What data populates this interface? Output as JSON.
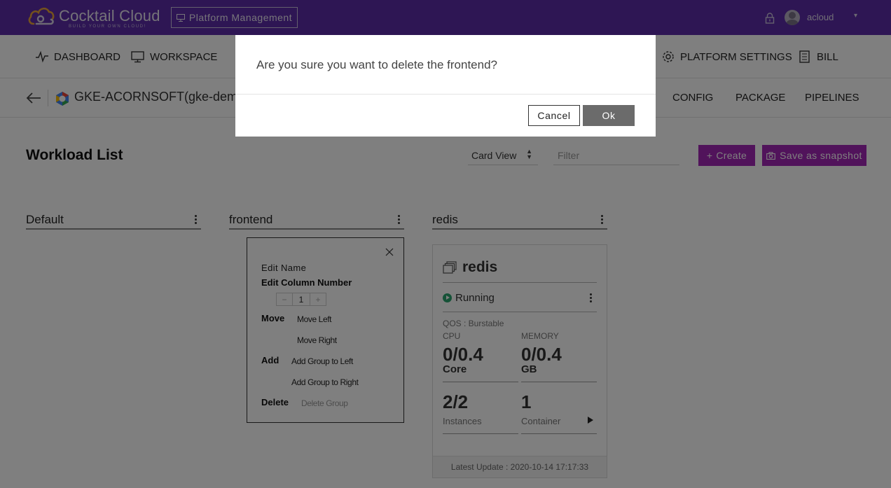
{
  "header": {
    "logo_title": "Cocktail Cloud",
    "logo_tagline": "BUILD YOUR OWN CLOUD!",
    "platform_button": "Platform Management",
    "user_name": "acloud",
    "user_caret": "▾"
  },
  "nav": {
    "items": [
      {
        "label": "DASHBOARD",
        "icon": "pulse-icon"
      },
      {
        "label": "WORKSPACE",
        "icon": "monitor-icon"
      },
      {
        "label": "PLATFORM SETTINGS",
        "icon": "gear-icon"
      },
      {
        "label": "BILL",
        "icon": "document-icon"
      }
    ]
  },
  "cluster": {
    "name": "GKE-ACORNSOFT(gke-demo)",
    "tabs": [
      "CONFIG",
      "PACKAGE",
      "PIPELINES"
    ]
  },
  "toolbar": {
    "page_title": "Workload List",
    "view_mode": "Card View",
    "filter_placeholder": "Filter",
    "create_label": "Create",
    "create_plus": "+",
    "snapshot_label": "Save as snapshot"
  },
  "groups": [
    {
      "name": "Default"
    },
    {
      "name": "frontend"
    },
    {
      "name": "redis"
    }
  ],
  "workload_card": {
    "name": "redis",
    "status": "Running",
    "qos": "QOS : Burstable",
    "cpu_label": "CPU",
    "cpu_value": "0/0.4",
    "cpu_unit": "Core",
    "memory_label": "MEMORY",
    "memory_value": "0/0.4",
    "memory_unit": "GB",
    "instances_value": "2/2",
    "instances_label": "Instances",
    "container_value": "1",
    "container_label": "Container",
    "latest_update": "Latest Update : 2020-10-14 17:17:33"
  },
  "group_menu": {
    "edit_name": "Edit Name",
    "edit_column": "Edit Column Number",
    "column_number": "1",
    "minus": "−",
    "plus": "+",
    "move_label": "Move",
    "move_left": "Move Left",
    "move_right": "Move Right",
    "add_label": "Add",
    "add_left": "Add Group to Left",
    "add_right": "Add Group to Right",
    "delete_label": "Delete",
    "delete_group": "Delete Group"
  },
  "modal": {
    "message": "Are you sure you want to delete the frontend?",
    "cancel": "Cancel",
    "ok": "Ok"
  },
  "colors": {
    "header_bg": "#5d2ca8",
    "accent_button": "#a226b6",
    "running_green": "#2aa56f",
    "ok_button": "#6b6b6b"
  }
}
